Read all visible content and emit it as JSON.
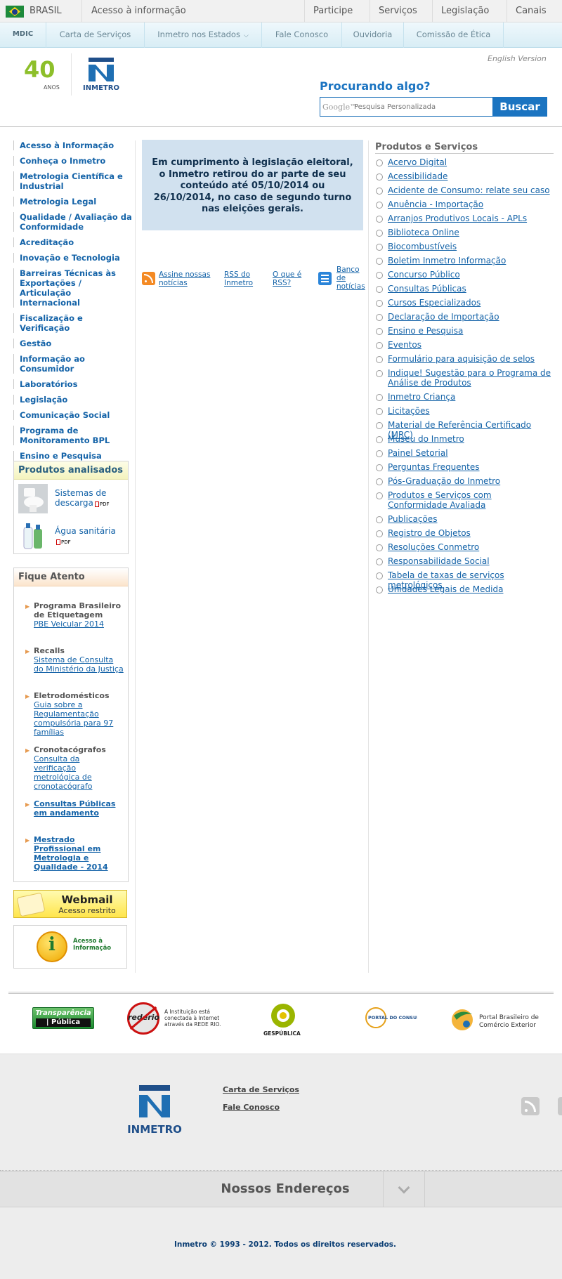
{
  "gov_bar": {
    "country": "BRASIL",
    "acesso": "Acesso à informação",
    "items": [
      "Participe",
      "Serviços",
      "Legislação",
      "Canais"
    ]
  },
  "mdic_bar": {
    "mdic": "MDIC",
    "items": [
      "Carta de Serviços",
      "Inmetro nos Estados",
      "Fale Conosco",
      "Ouvidoria",
      "Comissão de Ética"
    ]
  },
  "header": {
    "english": "English Version",
    "logo40_number": "40",
    "logo40_sub": "ANOS",
    "logo_inmetro": "INMETRO",
    "search_title": "Procurando algo?",
    "search_google": "Google™",
    "search_placeholder": "Pesquisa Personalizada",
    "search_button": "Buscar"
  },
  "left_nav": [
    "Acesso à Informação",
    "Conheça o Inmetro",
    "Metrologia Científica e Industrial",
    "Metrologia Legal",
    "Qualidade / Avaliação da Conformidade",
    "Acreditação",
    "Inovação e Tecnologia",
    "Barreiras Técnicas às Exportações / Articulação Internacional",
    "Fiscalização e Verificação",
    "Gestão",
    "Informação ao Consumidor",
    "Laboratórios",
    "Legislação",
    "Comunicação Social",
    "Programa de Monitoramento BPL",
    "Ensino e Pesquisa"
  ],
  "produtos_box": {
    "title": "Produtos analisados",
    "pdf": "PDF",
    "items": [
      "Sistemas de descarga",
      "Água sanitária"
    ]
  },
  "fique_box": {
    "title": "Fique Atento",
    "items": [
      {
        "title": "Programa Brasileiro de Etiquetagem",
        "link": "PBE Veicular 2014"
      },
      {
        "title": "Recalls",
        "link": "Sistema de Consulta do Ministério da Justiça"
      },
      {
        "title": "Eletrodomésticos",
        "link": "Guia sobre a Regulamentação compulsória para 97 famílias"
      },
      {
        "title": "Cronotacógrafos",
        "link": "Consulta da verificação metrológica de cronotacógrafo"
      },
      {
        "title": "",
        "link": "Consultas Públicas em andamento"
      },
      {
        "title": "",
        "link": "Mestrado Profissional em Metrologia e Qualidade - 2014"
      }
    ]
  },
  "webmail": {
    "title": "Webmail",
    "sub": "Acesso restrito"
  },
  "acesso_badge": {
    "line1": "Acesso à",
    "line2": "Informação"
  },
  "notice": "Em cumprimento à legislação eleitoral, o Inmetro retirou do ar parte de seu conteúdo até 05/10/2014 ou 26/10/2014, no caso de segundo turno nas eleições gerais.",
  "rss_links": {
    "assine": "Assine nossas notícias",
    "rss_inmetro": "RSS do Inmetro",
    "oque": "O que é RSS?",
    "banco": "Banco de notícias"
  },
  "right_col": {
    "title": "Produtos e Serviços",
    "items": [
      "Acervo Digital",
      "Acessibilidade",
      "Acidente de Consumo: relate seu caso",
      "Anuência - Importação",
      "Arranjos Produtivos Locais - APLs",
      "Biblioteca Online",
      "Biocombustíveis",
      "Boletim Inmetro Informação",
      "Concurso Público",
      "Consultas Públicas",
      "Cursos Especializados",
      "Declaração de Importação",
      "Ensino e Pesquisa",
      "Eventos",
      "Formulário para aquisição de selos",
      "Indique! Sugestão para o Programa de Análise de Produtos",
      "Inmetro Criança",
      "Licitações",
      "Material de Referência Certificado (MRC)",
      "Museu do Inmetro",
      "Painel Setorial",
      "Perguntas Frequentes",
      "Pós-Graduação do Inmetro",
      "Produtos e Serviços com Conformidade Avaliada",
      "Publicações",
      "Registro de Objetos",
      "Resoluções Conmetro",
      "Responsabilidade Social",
      "Tabela de taxas de serviços metrológicos",
      "Unidades Legais de Medida"
    ]
  },
  "partners": {
    "transparencia_1": "Transparência",
    "transparencia_2": "| Pública",
    "rederio_logo": "rederio",
    "rederio_text": "A Instituição está conectada à Internet através da REDE RIO.",
    "gespublica": "GESPÚBLICA",
    "portal_consumidor": "PORTAL DO CONSUMIDOR",
    "portal_brasileiro": "Portal Brasileiro de Comércio Exterior"
  },
  "footer": {
    "logo": "INMETRO",
    "links": [
      "Carta de Serviços",
      "Fale Conosco"
    ],
    "enderecos": "Nossos Endereços",
    "copyright": "Inmetro © 1993 - 2012. Todos os direitos reservados."
  }
}
